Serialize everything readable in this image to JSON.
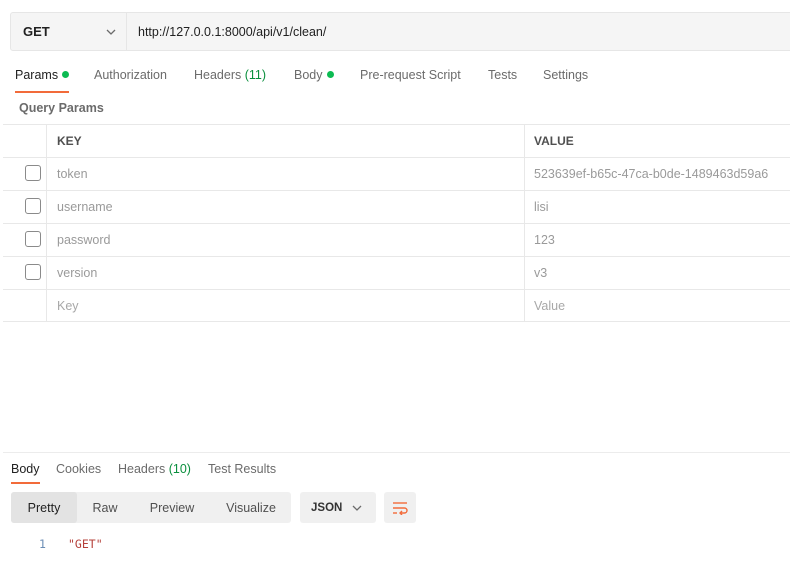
{
  "request": {
    "method": "GET",
    "url": "http://127.0.0.1:8000/api/v1/clean/"
  },
  "request_tabs": [
    {
      "label": "Params",
      "dot": true,
      "active": true
    },
    {
      "label": "Authorization"
    },
    {
      "label": "Headers",
      "count": "(11)"
    },
    {
      "label": "Body",
      "dot": true
    },
    {
      "label": "Pre-request Script"
    },
    {
      "label": "Tests"
    },
    {
      "label": "Settings"
    }
  ],
  "params": {
    "section_title": "Query Params",
    "columns": {
      "key": "KEY",
      "value": "VALUE"
    },
    "rows": [
      {
        "key": "token",
        "value": "523639ef-b65c-47ca-b0de-1489463d59a6",
        "checked": false
      },
      {
        "key": "username",
        "value": "lisi",
        "checked": false
      },
      {
        "key": "password",
        "value": "123",
        "checked": false
      },
      {
        "key": "version",
        "value": "v3",
        "checked": false
      }
    ],
    "placeholders": {
      "key": "Key",
      "value": "Value"
    }
  },
  "response_tabs": [
    {
      "label": "Body",
      "active": true
    },
    {
      "label": "Cookies"
    },
    {
      "label": "Headers",
      "count": "(10)"
    },
    {
      "label": "Test Results"
    }
  ],
  "view_modes": [
    {
      "label": "Pretty",
      "active": true
    },
    {
      "label": "Raw"
    },
    {
      "label": "Preview"
    },
    {
      "label": "Visualize"
    }
  ],
  "format": "JSON",
  "response_body": {
    "line_number": "1",
    "text": "\"GET\""
  },
  "colors": {
    "accent": "#f26b3a",
    "dot": "#0cbb52",
    "count": "#0a8f3d",
    "string": "#b5403a"
  },
  "icons": {
    "method_dropdown": "chevron-down-icon",
    "format_dropdown": "chevron-down-icon",
    "wrap": "wrap-lines-icon"
  }
}
